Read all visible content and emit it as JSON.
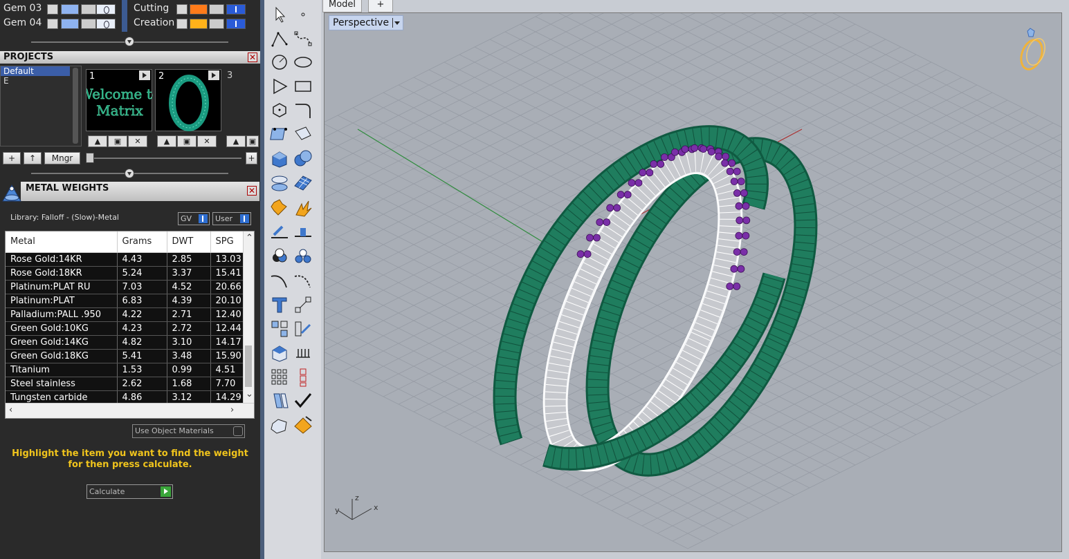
{
  "layers": {
    "rows": [
      {
        "name": "Gem 03",
        "color": "#8fb3f0"
      },
      {
        "name": "Gem 04",
        "color": "#8fb3f0"
      },
      {
        "name": "Cutting",
        "color": "#ff7b1a"
      },
      {
        "name": "Creation",
        "color": "#ffb21a"
      }
    ]
  },
  "projects": {
    "title": "PROJECTS",
    "list": [
      "Default",
      "E"
    ],
    "thumbnails": [
      {
        "num": "1",
        "caption": "Welcome to Matrix"
      },
      {
        "num": "2",
        "caption": ""
      },
      {
        "num": "3",
        "caption": ""
      }
    ],
    "buttons": {
      "add": "+",
      "up": "↑",
      "manager": "Mngr",
      "plus": "+"
    }
  },
  "metal_weights": {
    "title": "METAL WEIGHTS",
    "library_label": "Library: Falloff - (Slow)-Metal",
    "toggle_gv": "GV",
    "toggle_user": "User",
    "columns": [
      "Metal",
      "Grams",
      "DWT",
      "SPG"
    ],
    "rows": [
      [
        "Rose Gold:14KR",
        "4.43",
        "2.85",
        "13.03"
      ],
      [
        "Rose Gold:18KR",
        "5.24",
        "3.37",
        "15.41"
      ],
      [
        "Platinum:PLAT RU",
        "7.03",
        "4.52",
        "20.66"
      ],
      [
        "Platinum:PLAT",
        "6.83",
        "4.39",
        "20.10"
      ],
      [
        "Palladium:PALL .950",
        "4.22",
        "2.71",
        "12.40"
      ],
      [
        "Green Gold:10KG",
        "4.23",
        "2.72",
        "12.44"
      ],
      [
        "Green Gold:14KG",
        "4.82",
        "3.10",
        "14.17"
      ],
      [
        "Green Gold:18KG",
        "5.41",
        "3.48",
        "15.90"
      ],
      [
        "Titanium",
        "1.53",
        "0.99",
        "4.51"
      ],
      [
        "Steel stainless",
        "2.62",
        "1.68",
        "7.70"
      ],
      [
        "Tungsten carbide",
        "4.86",
        "3.12",
        "14.29"
      ]
    ],
    "use_object_materials": "Use Object Materials",
    "hint_line1": "Highlight the item you want to find the weight",
    "hint_line2": "for then press calculate.",
    "calculate": "Calculate"
  },
  "viewport": {
    "tabs": [
      "Model",
      "+"
    ],
    "view_name": "Perspective",
    "axes": {
      "x": "x",
      "y": "y",
      "z": "z"
    }
  },
  "colors": {
    "ring_green": "#1f7d5e",
    "ring_silver": "#d9dbe0",
    "gem_purple": "#7a2fa8",
    "accent_yellow": "#f0c41c"
  }
}
